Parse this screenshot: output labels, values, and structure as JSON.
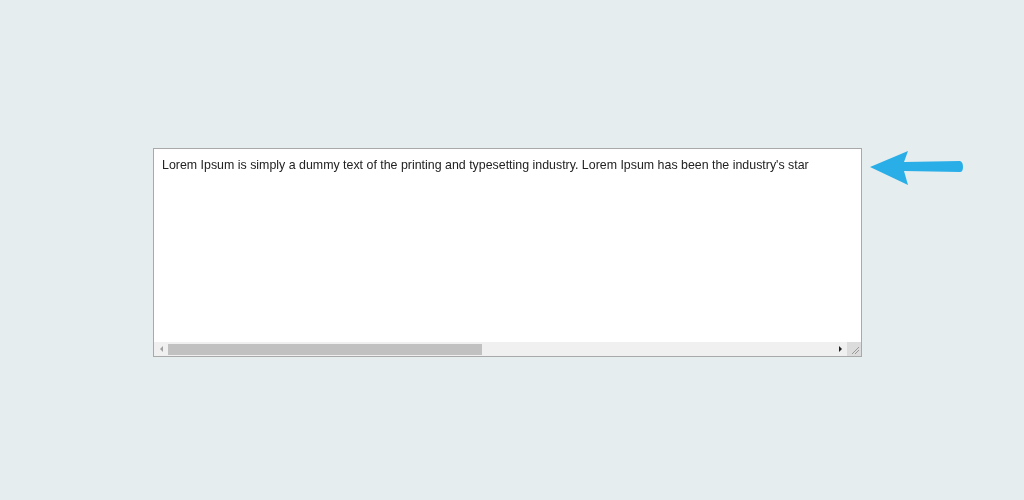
{
  "textarea": {
    "value": "Lorem Ipsum is simply a dummy text of the printing and typesetting industry. Lorem Ipsum has been the industry's star"
  }
}
